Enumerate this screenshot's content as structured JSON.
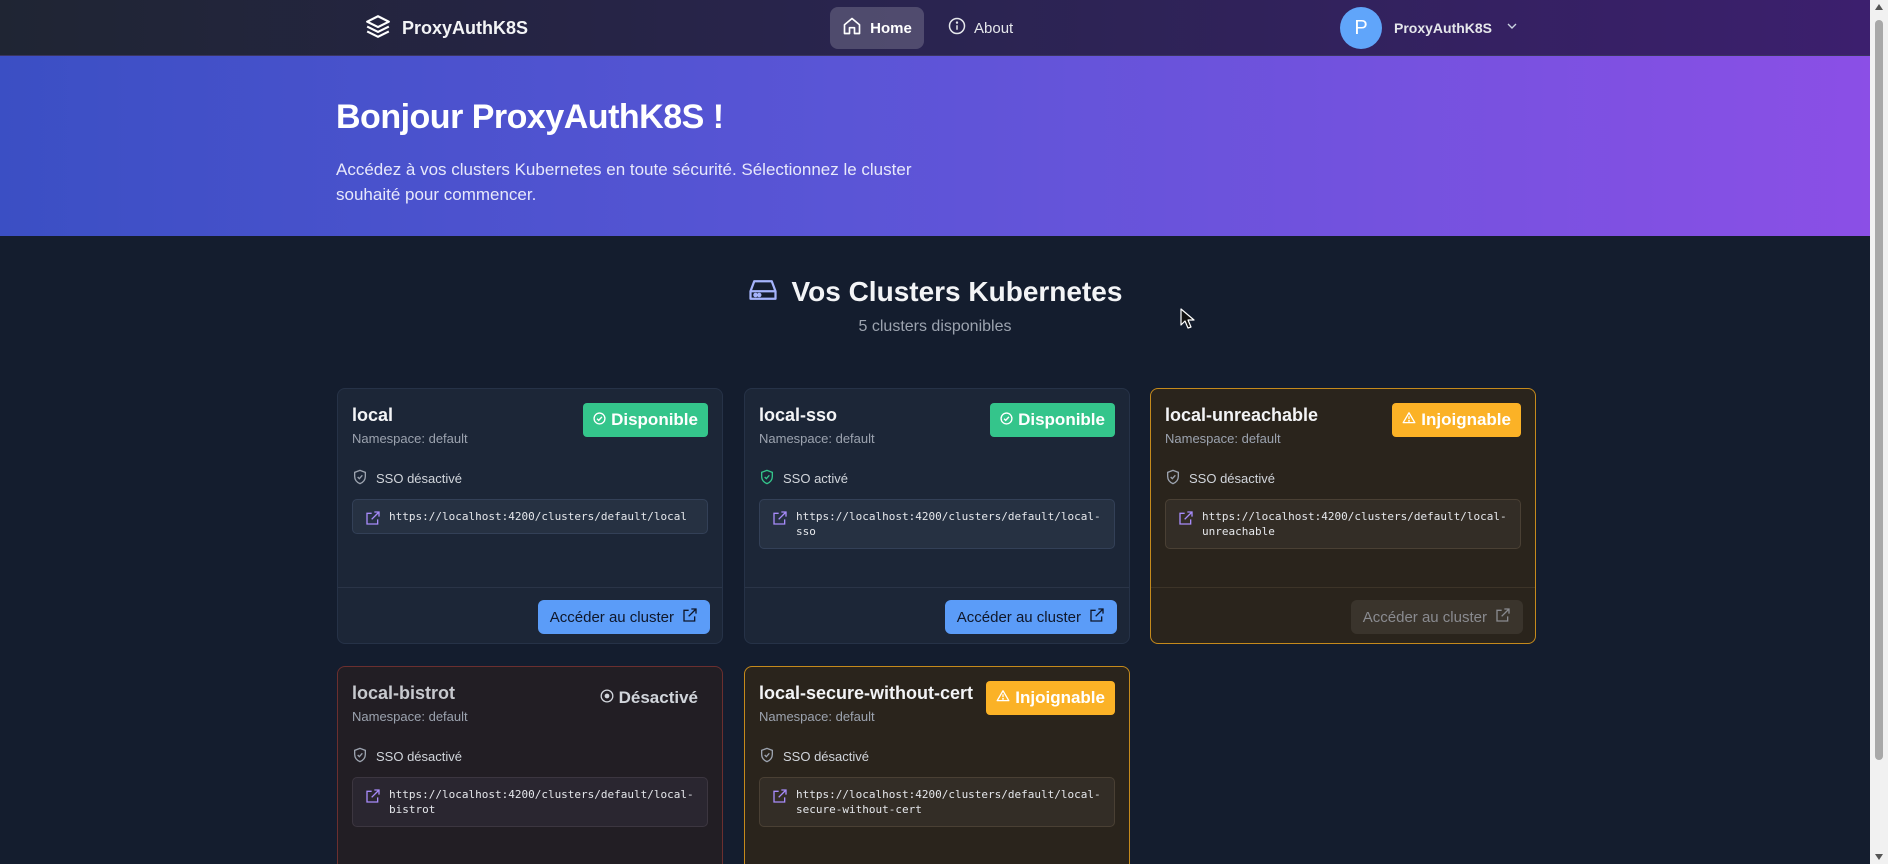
{
  "nav": {
    "brand": "ProxyAuthK8S",
    "home_label": "Home",
    "about_label": "About",
    "user_initial": "P",
    "user_name": "ProxyAuthK8S"
  },
  "hero": {
    "title": "Bonjour ProxyAuthK8S !",
    "subtitle": "Accédez à vos clusters Kubernetes en toute sécurité. Sélectionnez le cluster souhaité pour commencer."
  },
  "section": {
    "title": "Vos Clusters Kubernetes",
    "count": "5 clusters disponibles"
  },
  "clusters": [
    {
      "name": "local",
      "namespace": "Namespace: default",
      "status": "Disponible",
      "sso": "SSO désactivé",
      "url": "https://localhost:4200/clusters/default/local",
      "button": "Accéder au cluster"
    },
    {
      "name": "local-sso",
      "namespace": "Namespace: default",
      "status": "Disponible",
      "sso": "SSO activé",
      "url": "https://localhost:4200/clusters/default/local-sso",
      "button": "Accéder au cluster"
    },
    {
      "name": "local-unreachable",
      "namespace": "Namespace: default",
      "status": "Injoignable",
      "sso": "SSO désactivé",
      "url": "https://localhost:4200/clusters/default/local-unreachable",
      "button": "Accéder au cluster"
    },
    {
      "name": "local-bistrot",
      "namespace": "Namespace: default",
      "status": "Désactivé",
      "sso": "SSO désactivé",
      "url": "https://localhost:4200/clusters/default/local-bistrot"
    },
    {
      "name": "local-secure-without-cert",
      "namespace": "Namespace: default",
      "status": "Injoignable",
      "sso": "SSO désactivé",
      "url": "https://localhost:4200/clusters/default/local-secure-without-cert"
    }
  ],
  "colors": {
    "available": "#34c58b",
    "unreachable": "#fbb226",
    "button": "#5b9cf8",
    "hero_start": "#3b4fc4",
    "hero_end": "#8b4fe6"
  }
}
